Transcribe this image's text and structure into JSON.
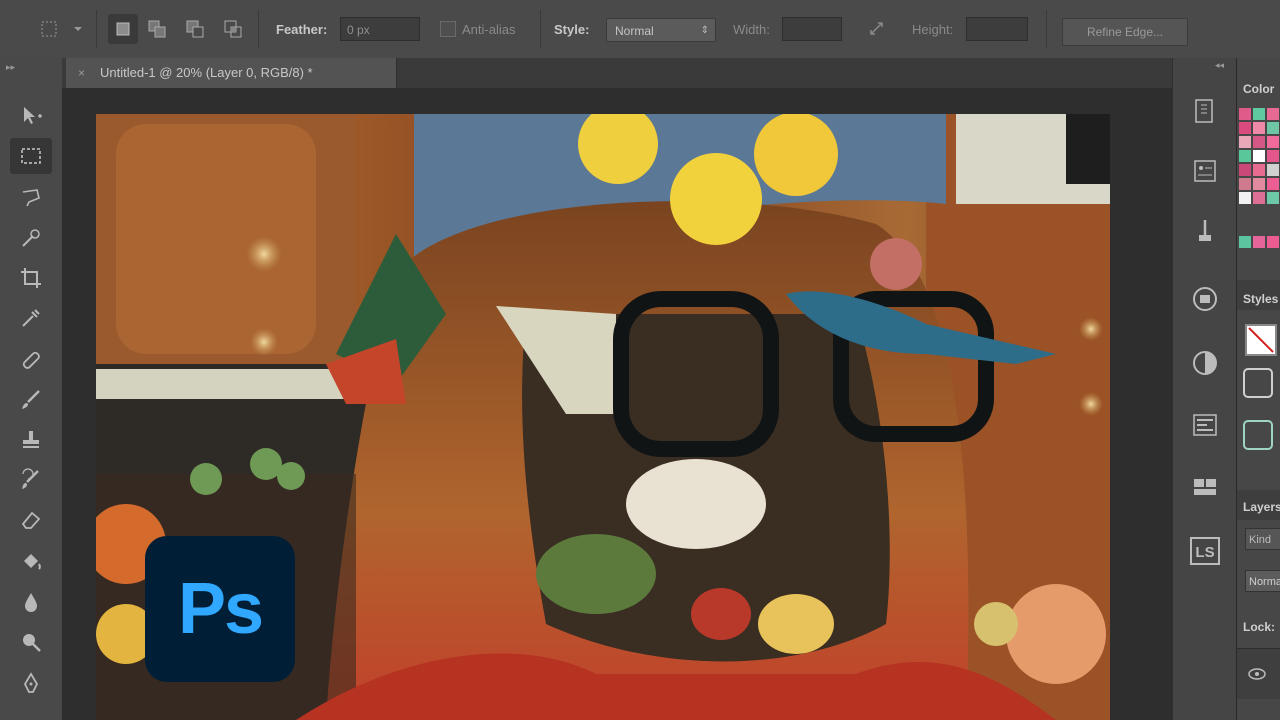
{
  "options_bar": {
    "feather_label": "Feather:",
    "feather_value": "0 px",
    "antialias_label": "Anti-alias",
    "style_label": "Style:",
    "style_value": "Normal",
    "width_label": "Width:",
    "height_label": "Height:",
    "refine_label": "Refine Edge..."
  },
  "document": {
    "tab_title": "Untitled-1 @ 20% (Layer 0, RGB/8) *",
    "close_glyph": "×"
  },
  "panels": {
    "color_tab": "Color",
    "styles_tab": "Styles",
    "layers_tab": "Layers",
    "blend_mode": "Normal",
    "lock_label": "Lock:",
    "kind_filter": "Kind"
  },
  "badges": {
    "ps_logo": "Ps",
    "ls_icon": "LS"
  },
  "colors": {
    "ps_logo_bg": "#001e36",
    "ps_logo_fg": "#31a8ff"
  }
}
